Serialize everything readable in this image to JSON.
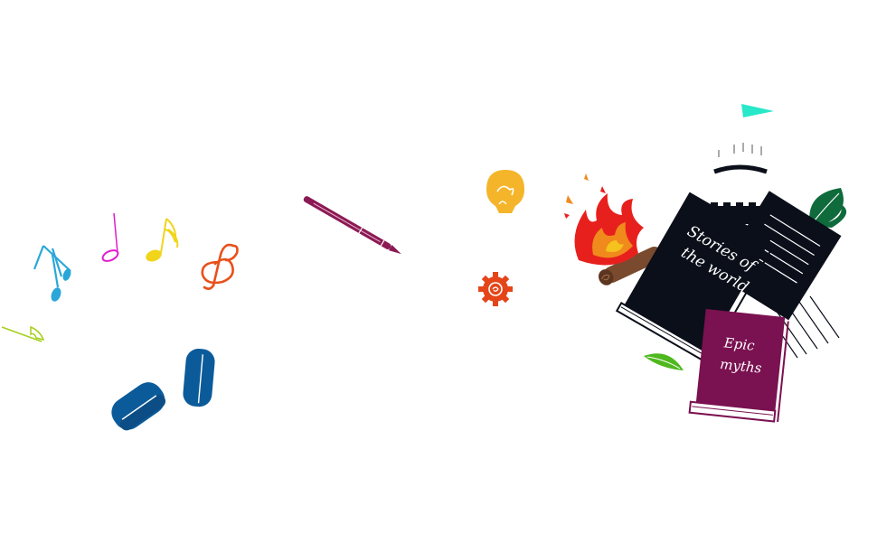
{
  "books": {
    "black_book_title": [
      "Stories of",
      "the world"
    ],
    "purple_book_title": [
      "Epic",
      "myths"
    ]
  },
  "colors": {
    "black_book": "#0b0f1a",
    "purple_book": "#7a1150",
    "pen": "#8b1a54",
    "flame_red": "#e8201d",
    "flame_orange": "#f08a1c",
    "log": "#7a4a2e",
    "bulb": "#f4b52a",
    "gear": "#e4461a",
    "headphones": "#0b5b9a",
    "leaf_dark": "#0f6b3c",
    "leaf_light": "#4fb81e",
    "flag": "#27e8c8",
    "note_cyan": "#2aa7d8",
    "note_magenta": "#e21ccf",
    "note_yellow": "#f0d51a",
    "clef_orange": "#e8501a",
    "note_lime": "#a5cf1a"
  },
  "icons": [
    "music-note-icon",
    "treble-clef-icon",
    "headphones-icon",
    "pen-icon",
    "lightbulb-icon",
    "gear-icon",
    "campfire-icon",
    "book-icon",
    "notebook-icon",
    "leaf-icon",
    "castle-tower-icon",
    "flag-icon"
  ]
}
